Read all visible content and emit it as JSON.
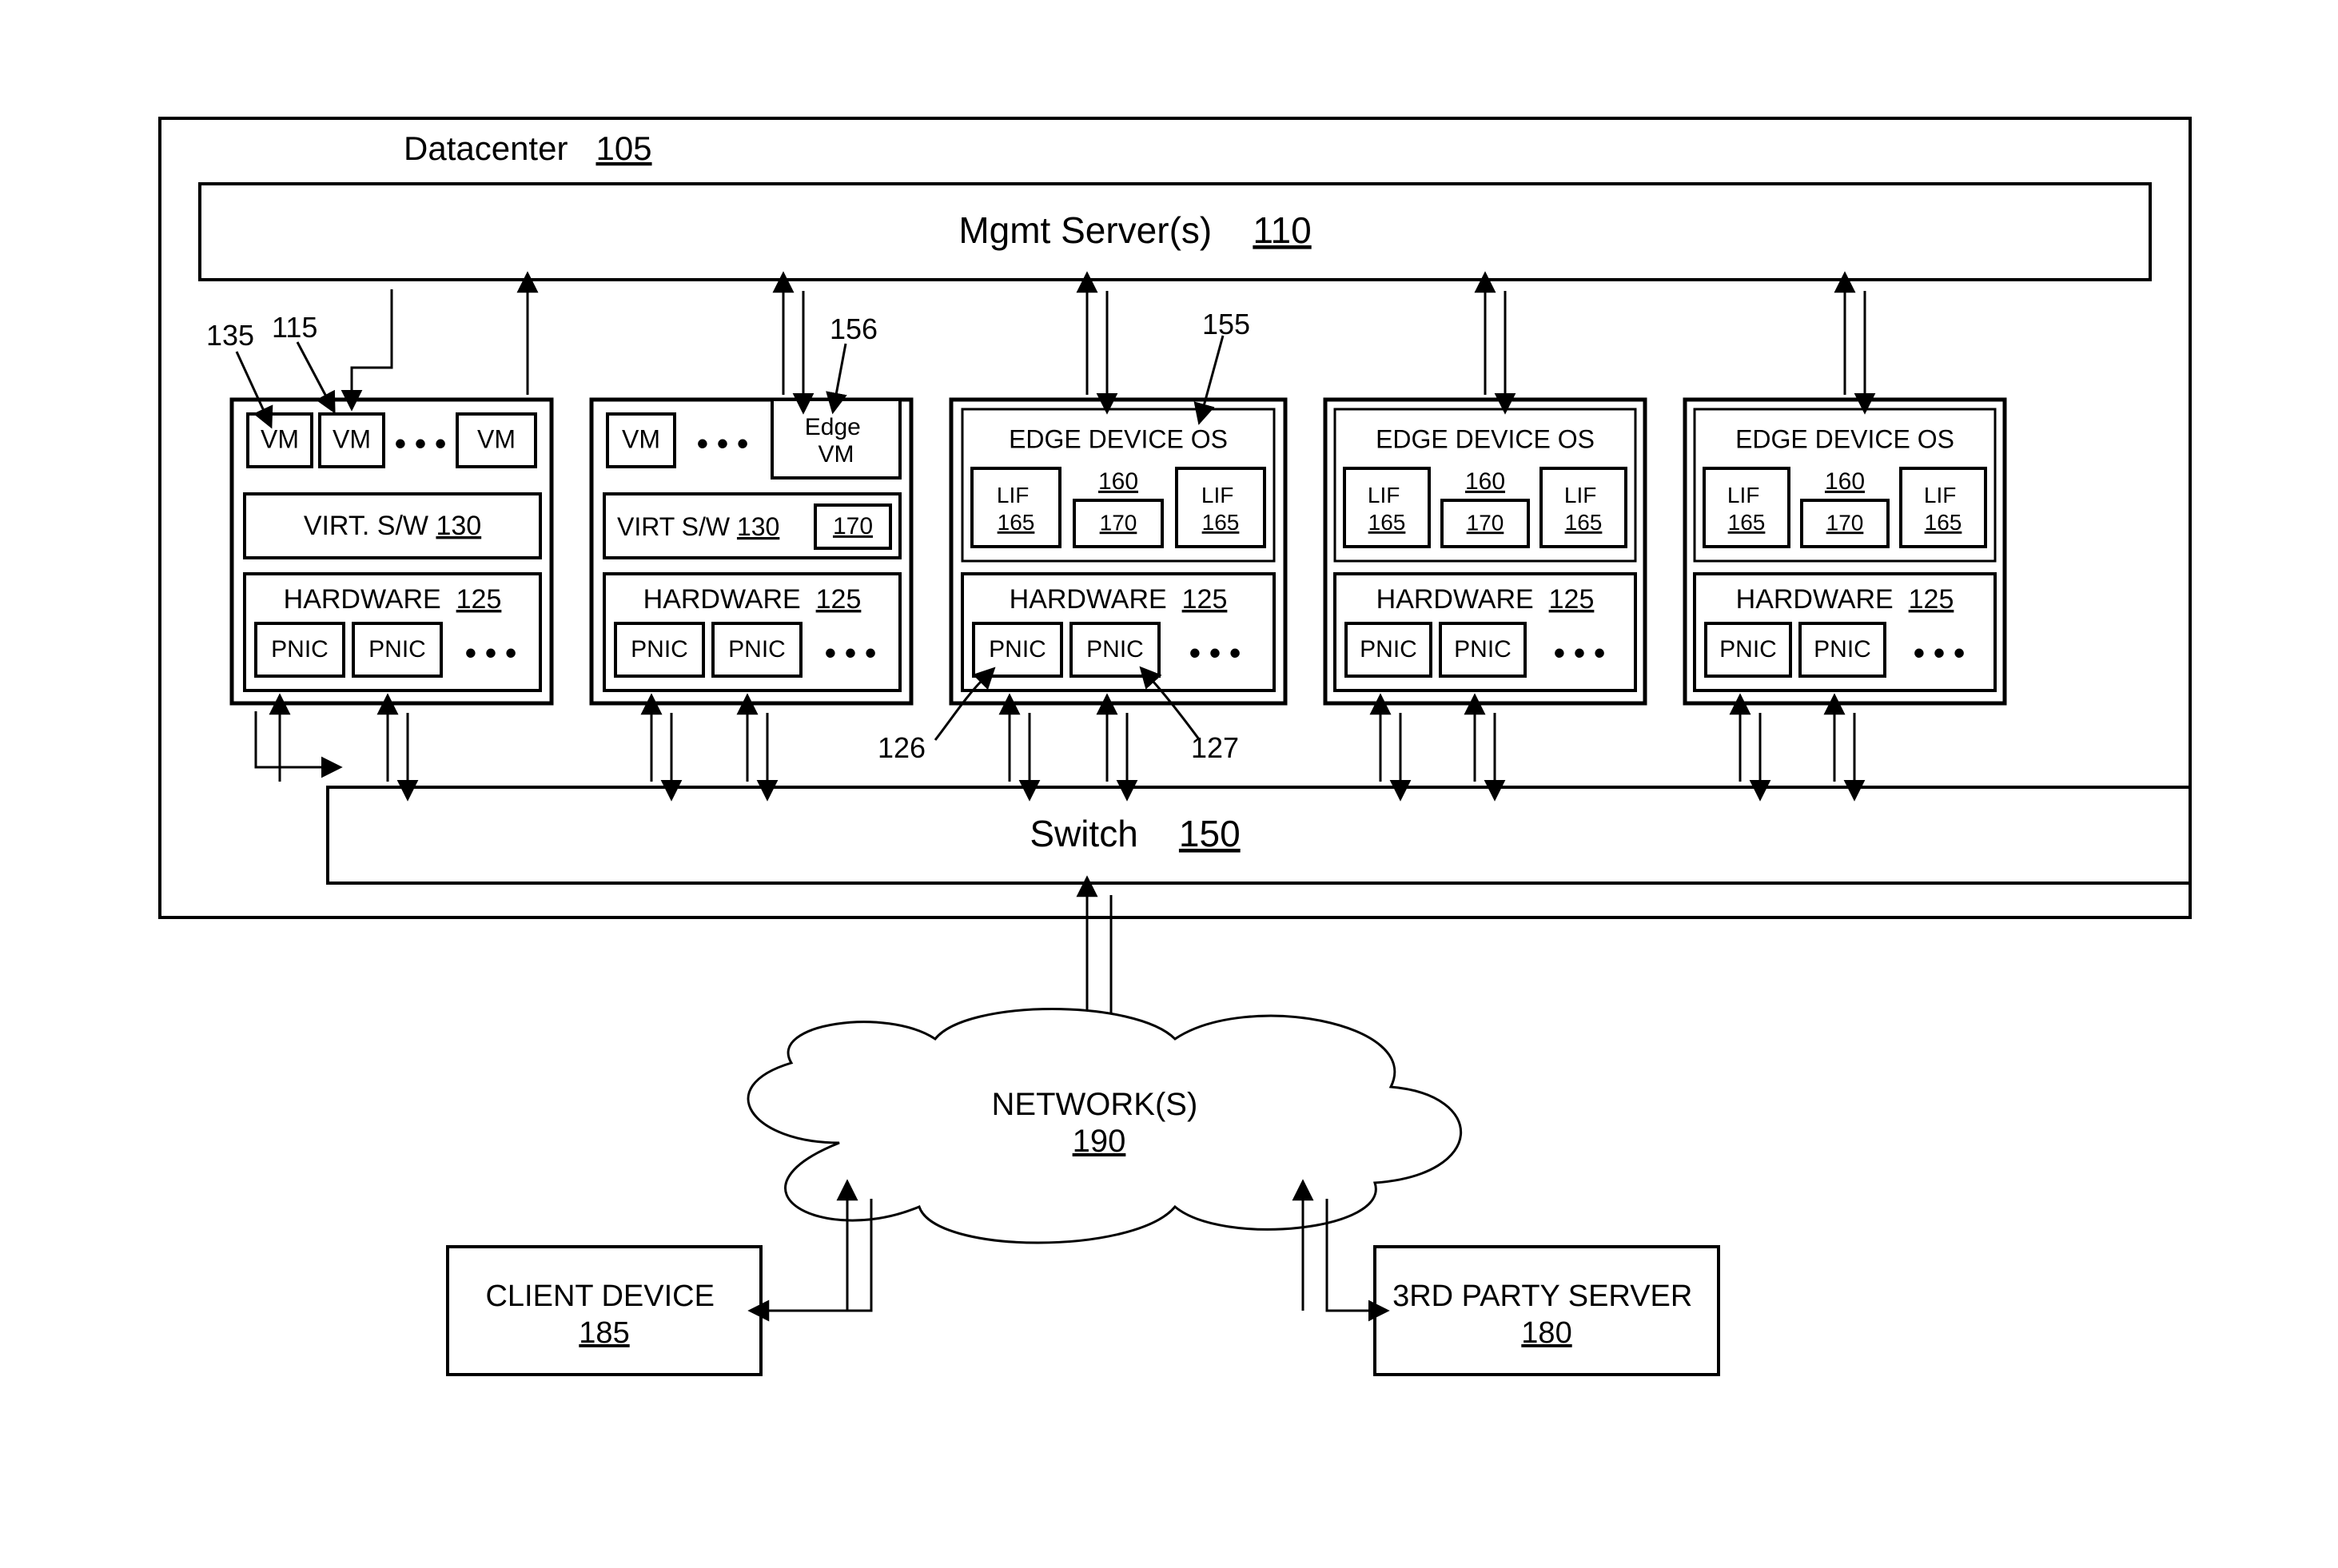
{
  "datacenter": {
    "label": "Datacenter",
    "ref": "105"
  },
  "mgmt": {
    "label": "Mgmt Server(s)",
    "ref": "110"
  },
  "switch": {
    "label": "Switch",
    "ref": "150"
  },
  "network": {
    "label": "NETWORK(S)",
    "ref": "190"
  },
  "client": {
    "label": "CLIENT DEVICE",
    "ref": "185"
  },
  "server3p": {
    "label": "3RD PARTY SERVER",
    "ref": "180"
  },
  "callouts": {
    "c135": "135",
    "c115": "115",
    "c156": "156",
    "c155": "155",
    "c126": "126",
    "c127": "127"
  },
  "host1": {
    "vm": "VM",
    "dots": "• • •",
    "virt_label": "VIRT. S/W",
    "virt_ref": "130",
    "hw_label": "HARDWARE",
    "hw_ref": "125",
    "pnic": "PNIC"
  },
  "host2": {
    "vm": "VM",
    "edge_vm": "Edge VM",
    "dots": "• • •",
    "virt_label": "VIRT S/W",
    "virt_ref": "130",
    "extra_ref": "170",
    "hw_label": "HARDWARE",
    "hw_ref": "125",
    "pnic": "PNIC"
  },
  "edge": {
    "os_label": "EDGE DEVICE OS",
    "os_ref": "160",
    "lif": "LIF",
    "lif_ref": "165",
    "mid_ref": "170",
    "hw_label": "HARDWARE",
    "hw_ref": "125",
    "pnic": "PNIC",
    "dots": "• • •"
  },
  "misc": {
    "dots": "• • •"
  }
}
